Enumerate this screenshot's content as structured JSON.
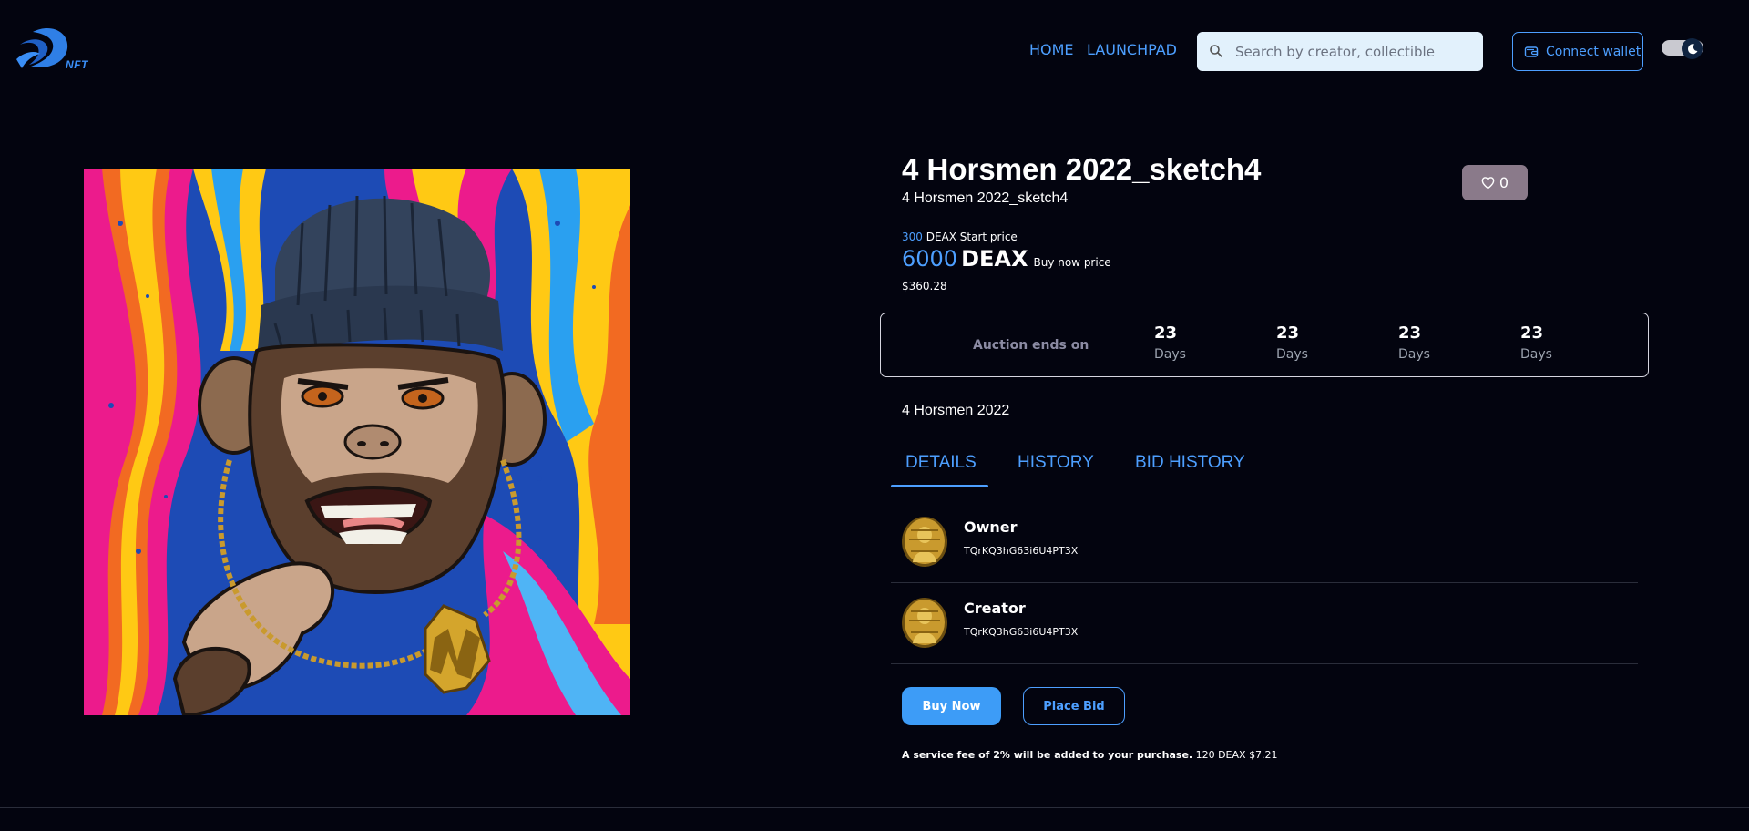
{
  "header": {
    "logo_text": "NFT",
    "nav": [
      {
        "label": "HOME"
      },
      {
        "label": "LAUNCHPAD"
      }
    ],
    "search": {
      "placeholder": "Search by creator, collectible",
      "value": ""
    },
    "connect_label": "Connect wallet",
    "theme_toggle": {
      "state": "dark"
    }
  },
  "item": {
    "title": "4 Horsmen 2022_sketch4",
    "subtitle": "4 Horsmen 2022_sketch4",
    "likes": "0",
    "start_price": {
      "value": "300",
      "label": "DEAX Start price"
    },
    "buy_price": {
      "value": "6000",
      "currency": "DEAX",
      "label": "Buy now price"
    },
    "usd": "$360.28",
    "collection": "4 Horsmen 2022"
  },
  "auction": {
    "label": "Auction ends on",
    "countdown": [
      {
        "value": "23",
        "unit": "Days"
      },
      {
        "value": "23",
        "unit": "Days"
      },
      {
        "value": "23",
        "unit": "Days"
      },
      {
        "value": "23",
        "unit": "Days"
      }
    ]
  },
  "tabs": [
    {
      "label": "DETAILS",
      "active": true
    },
    {
      "label": "HISTORY",
      "active": false
    },
    {
      "label": "BID HISTORY",
      "active": false
    }
  ],
  "people": [
    {
      "role": "Owner",
      "address": "TQrKQ3hG63i6U4PT3X"
    },
    {
      "role": "Creator",
      "address": "TQrKQ3hG63i6U4PT3X"
    }
  ],
  "actions": {
    "buy_now": "Buy Now",
    "place_bid": "Place Bid"
  },
  "fee": {
    "text": "A service fee of 2% will be added to your purchase.",
    "amount": "120 DEAX $7.21"
  },
  "colors": {
    "background": "#03040f",
    "accent": "#4d9fff",
    "like_bg": "#8a7a8a"
  }
}
